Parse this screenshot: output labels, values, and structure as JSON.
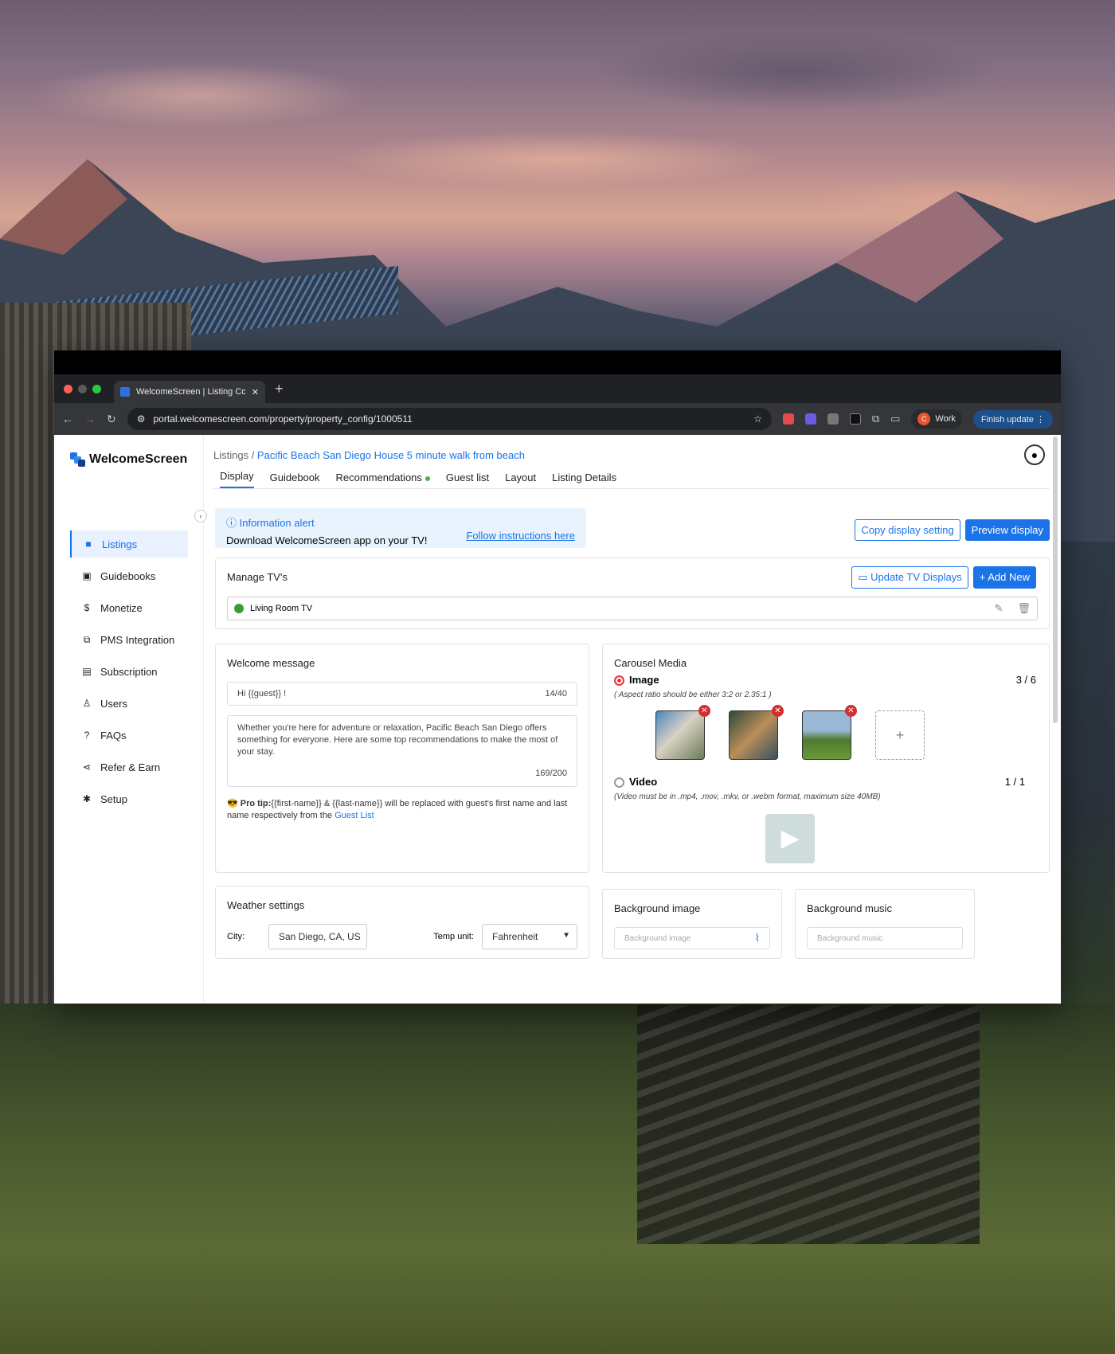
{
  "browser": {
    "tab_title": "WelcomeScreen | Listing Con",
    "url": "portal.welcomescreen.com/property/property_config/1000511",
    "profile_initial": "C",
    "profile_label": "Work",
    "finish_update_label": "Finish update"
  },
  "app": {
    "brand": "WelcomeScreen",
    "breadcrumb_root": "Listings",
    "breadcrumb_separator": " / ",
    "breadcrumb_current": "Pacific Beach San Diego House 5 minute walk from beach"
  },
  "sidebar": {
    "items": [
      {
        "label": "Listings",
        "icon": "listings-icon"
      },
      {
        "label": "Guidebooks",
        "icon": "book-icon"
      },
      {
        "label": "Monetize",
        "icon": "dollar-icon"
      },
      {
        "label": "PMS Integration",
        "icon": "puzzle-icon"
      },
      {
        "label": "Subscription",
        "icon": "subscription-icon"
      },
      {
        "label": "Users",
        "icon": "user-icon"
      },
      {
        "label": "FAQs",
        "icon": "question-icon"
      },
      {
        "label": "Refer & Earn",
        "icon": "share-icon"
      },
      {
        "label": "Setup",
        "icon": "gear-icon"
      }
    ]
  },
  "tabs": [
    "Display",
    "Guidebook",
    "Recommendations",
    "Guest list",
    "Layout",
    "Listing Details"
  ],
  "alert": {
    "title": "Information alert",
    "body": "Download WelcomeScreen app on your TV!",
    "link": "Follow instructions here"
  },
  "actions": {
    "copy": "Copy display setting",
    "preview": "Preview display"
  },
  "tv": {
    "title": "Manage TV's",
    "update_label": "Update TV Displays",
    "add_label": "Add New",
    "devices": [
      {
        "name": "Living Room TV"
      }
    ]
  },
  "welcome": {
    "title": "Welcome message",
    "greeting": "Hi {{guest}} !",
    "greeting_count": "14/40",
    "message": "Whether you're here for adventure or relaxation, Pacific Beach San Diego offers something for everyone. Here are some top recommendations to make the most of your stay.",
    "message_count": "169/200",
    "tip_bold": "Pro tip:",
    "tip_text": "{{first-name}} & {{last-name}} will be replaced with guest's first name and last name respectively from the",
    "tip_link": "Guest List"
  },
  "carousel": {
    "title": "Carousel Media",
    "image_label": "Image",
    "image_count": "3 / 6",
    "image_hint": "( Aspect ratio should be either 3:2 or 2.35:1 )",
    "video_label": "Video",
    "video_count": "1 / 1",
    "video_hint": "(Video must be in .mp4, .mov, .mkv, or .webm format, maximum size 40MB)"
  },
  "weather": {
    "title": "Weather settings",
    "city_label": "City:",
    "city_value": "San Diego, CA, US",
    "temp_label": "Temp unit:",
    "temp_value": "Fahrenheit"
  },
  "background_image": {
    "title": "Background image",
    "placeholder": "Background image"
  },
  "background_music": {
    "title": "Background music",
    "placeholder": "Background music"
  },
  "colors": {
    "accent": "#1a73e8",
    "active_bg": "#e8f1fd",
    "status_green": "#3a9b3a",
    "remove_red": "#d32f2f"
  }
}
